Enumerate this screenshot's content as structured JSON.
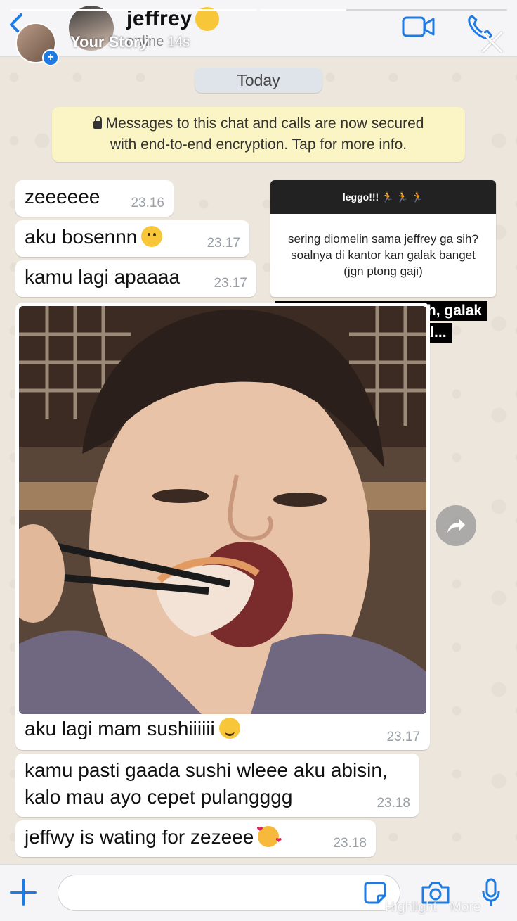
{
  "story_overlay": {
    "progress": [
      1,
      0.5,
      0
    ],
    "label": "Your Story",
    "time": "14s",
    "highlight_label": "Highlight",
    "more_label": "More"
  },
  "chat_header": {
    "contact_name": "jeffrey",
    "status": "online"
  },
  "day_separator": "Today",
  "encryption_notice": {
    "line1": "Messages to this chat and calls are now secured",
    "line2": "with end-to-end encryption. Tap for more info."
  },
  "messages": [
    {
      "text": "zeeeeee",
      "time": "23.16"
    },
    {
      "text": "aku bosennn",
      "time": "23.17",
      "emoji": "sad-face-icon"
    },
    {
      "text": "kamu lagi apaaaa",
      "time": "23.17"
    },
    {
      "text": "aku lagi mam sushiiiiii",
      "time": "23.17",
      "emoji": "yum-face-icon"
    },
    {
      "text": "kamu pasti gaada sushi wleee aku abisin,",
      "text2": "kalo mau ayo cepet pulangggg",
      "time": "23.18"
    },
    {
      "text": "jeffwy is wating for zezeee",
      "time": "23.18",
      "emoji": "smiling-hearts-face-icon"
    }
  ],
  "question_sticker": {
    "header": "leggo!!! 🏃 🏃 🏃",
    "question": "sering diomelin sama jeffrey ga sih? soalnya di kantor kan galak banget (jgn ptong gaji)",
    "answer_line1": "bisa diliat sendiri nihh, galak",
    "answer_line2": "dikantor padahal..."
  },
  "colors": {
    "accent": "#1e7be3",
    "bubble": "#ffffff",
    "system_notice": "#fbf4c4",
    "wallpaper": "#ece6dd"
  }
}
